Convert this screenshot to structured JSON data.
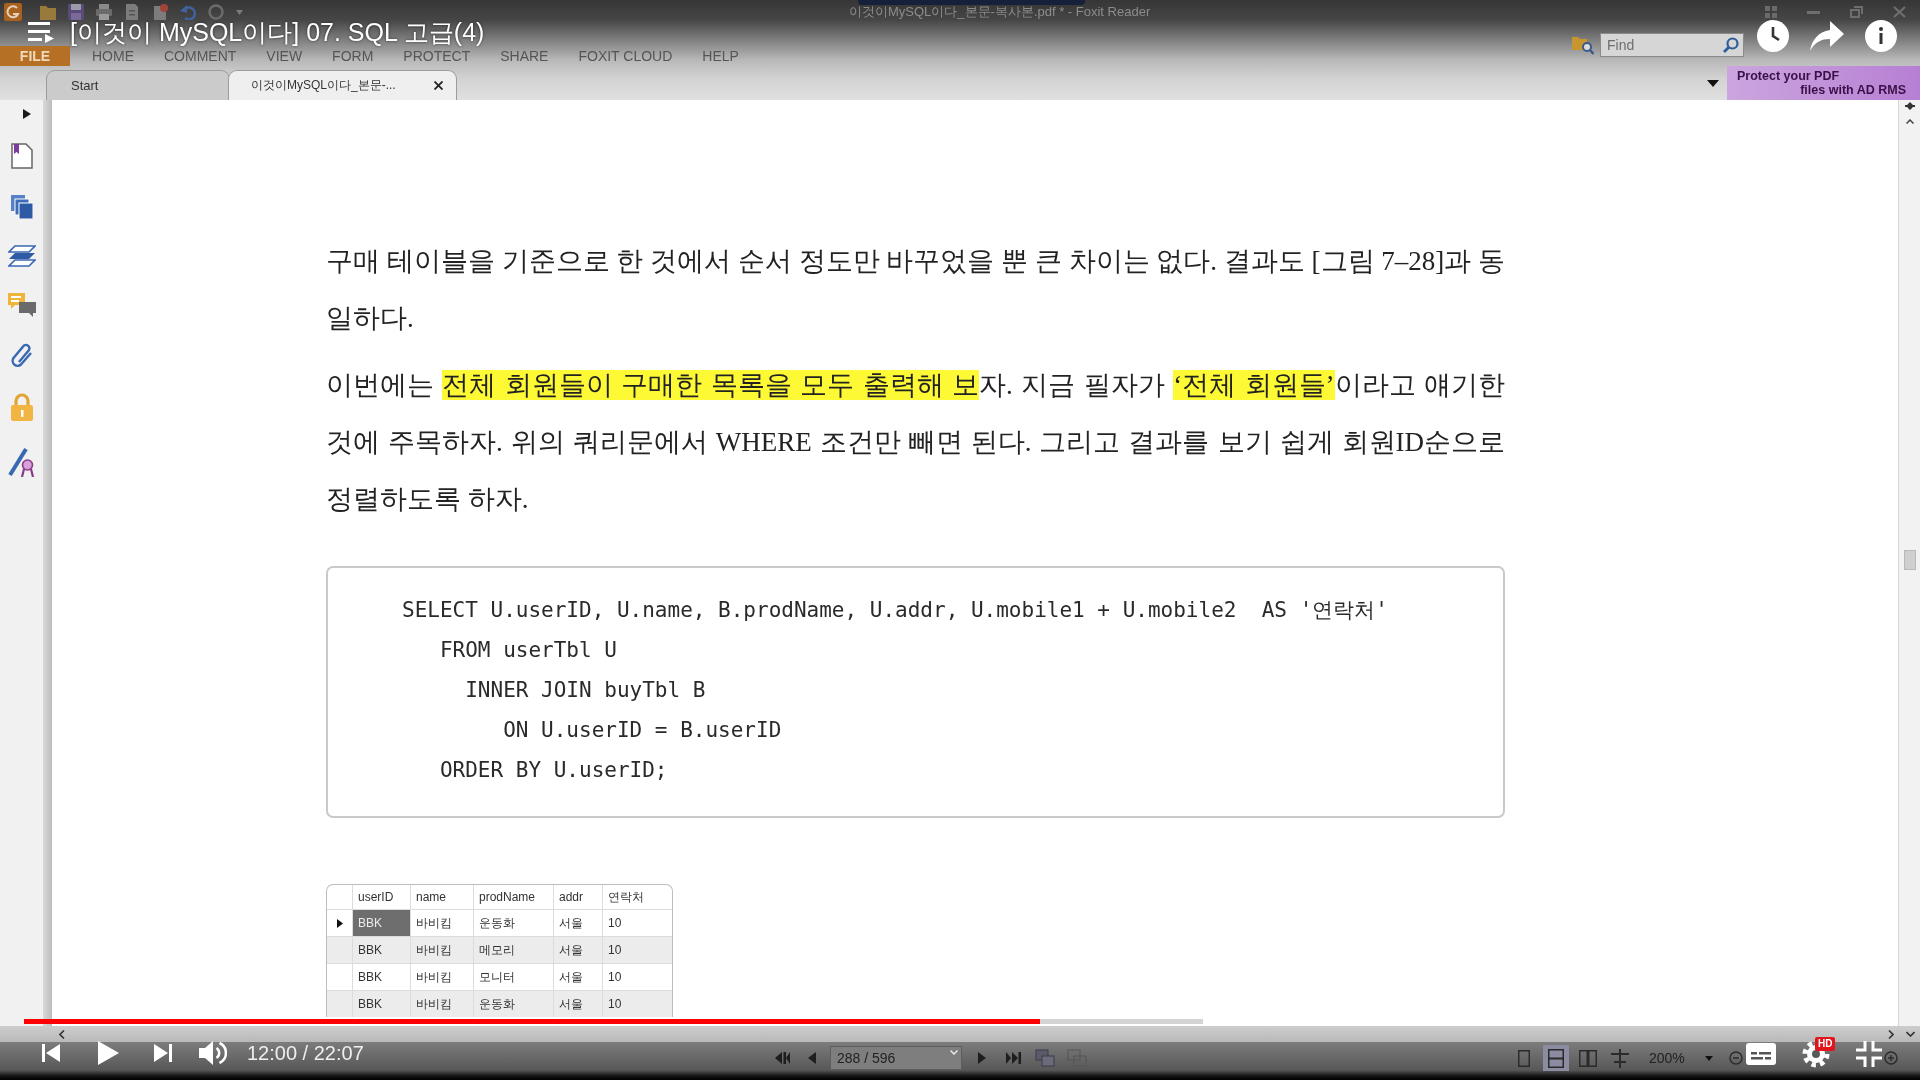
{
  "video": {
    "title": "[이것이 MySQL이다] 07. SQL 고급(4)",
    "progress": {
      "level": 0.543
    },
    "time": "12:00 / 22:07",
    "quality_badge": "HD"
  },
  "app": {
    "window_title": "이것이MySQL이다_본문-복사본.pdf * - Foxit Reader",
    "menu": [
      {
        "label": "FILE",
        "kind": "file"
      },
      {
        "label": "HOME",
        "kind": "tab"
      },
      {
        "label": "COMMENT",
        "kind": "tab"
      },
      {
        "label": "VIEW",
        "kind": "tab"
      },
      {
        "label": "FORM",
        "kind": "tab"
      },
      {
        "label": "PROTECT",
        "kind": "tab"
      },
      {
        "label": "SHARE",
        "kind": "tab"
      },
      {
        "label": "FOXIT CLOUD",
        "kind": "tab"
      },
      {
        "label": "HELP",
        "kind": "tab"
      }
    ],
    "search": {
      "placeholder": "Find"
    },
    "doc_tabs": [
      {
        "label": "Start",
        "selected": false
      },
      {
        "label": "이것이MySQL이다_본문-...",
        "selected": true
      }
    ],
    "ad_banner": {
      "lines": [
        "Protect your PDF",
        "files with AD RMS"
      ]
    },
    "document": {
      "paragraphs": [
        {
          "segments": [
            {
              "text": "구매 테이블을 기준으로 한 것에서 순서 정도만 바꾸었을 뿐 큰 차이는 없다. 결과도 [그림 7–28]과 동일하다.",
              "highlighted": false
            }
          ]
        },
        {
          "segments": [
            {
              "text": "이번에는 ",
              "highlighted": false
            },
            {
              "text": "전체 회원들이 구매한 목록을 모두 출력해 보",
              "highlighted": true
            },
            {
              "text": "자. 지금 필자가 ",
              "highlighted": false
            },
            {
              "text": "‘전체 회원들’",
              "highlighted": true
            },
            {
              "text": "이라고 얘기한 것에 주목하자. 위의 쿼리문에서 WHERE 조건만 빼면 된다. 그리고 결과를 보기 쉽게 회원ID순으로 정렬하도록 하자.",
              "highlighted": false
            }
          ]
        }
      ],
      "code": [
        "SELECT U.userID, U.name, B.prodName, U.addr, U.mobile1 + U.mobile2  AS '연락처'",
        "   FROM userTbl U",
        "     INNER JOIN buyTbl B",
        "        ON U.userID = B.userID",
        "   ORDER BY U.userID;"
      ],
      "result_table": {
        "columns": [
          "userID",
          "name",
          "prodName",
          "addr",
          "연락처"
        ],
        "rows": [
          {
            "selected": true,
            "cells": [
              "BBK",
              "바비킴",
              "운동화",
              "서울",
              "10"
            ]
          },
          {
            "selected": false,
            "cells": [
              "BBK",
              "바비킴",
              "메모리",
              "서울",
              "10"
            ]
          },
          {
            "selected": false,
            "cells": [
              "BBK",
              "바비킴",
              "모니터",
              "서울",
              "10"
            ]
          },
          {
            "selected": false,
            "cells": [
              "BBK",
              "바비킴",
              "운동화",
              "서울",
              "10"
            ]
          }
        ]
      }
    },
    "status_bar": {
      "page_field": {
        "value": "288 / 596"
      },
      "view_modes": [
        {
          "kind": "single",
          "selected": false
        },
        {
          "kind": "continuous",
          "selected": true
        },
        {
          "kind": "facing",
          "selected": false
        },
        {
          "kind": "split",
          "selected": false
        }
      ],
      "zoom_field": {
        "value": "200%"
      }
    }
  }
}
